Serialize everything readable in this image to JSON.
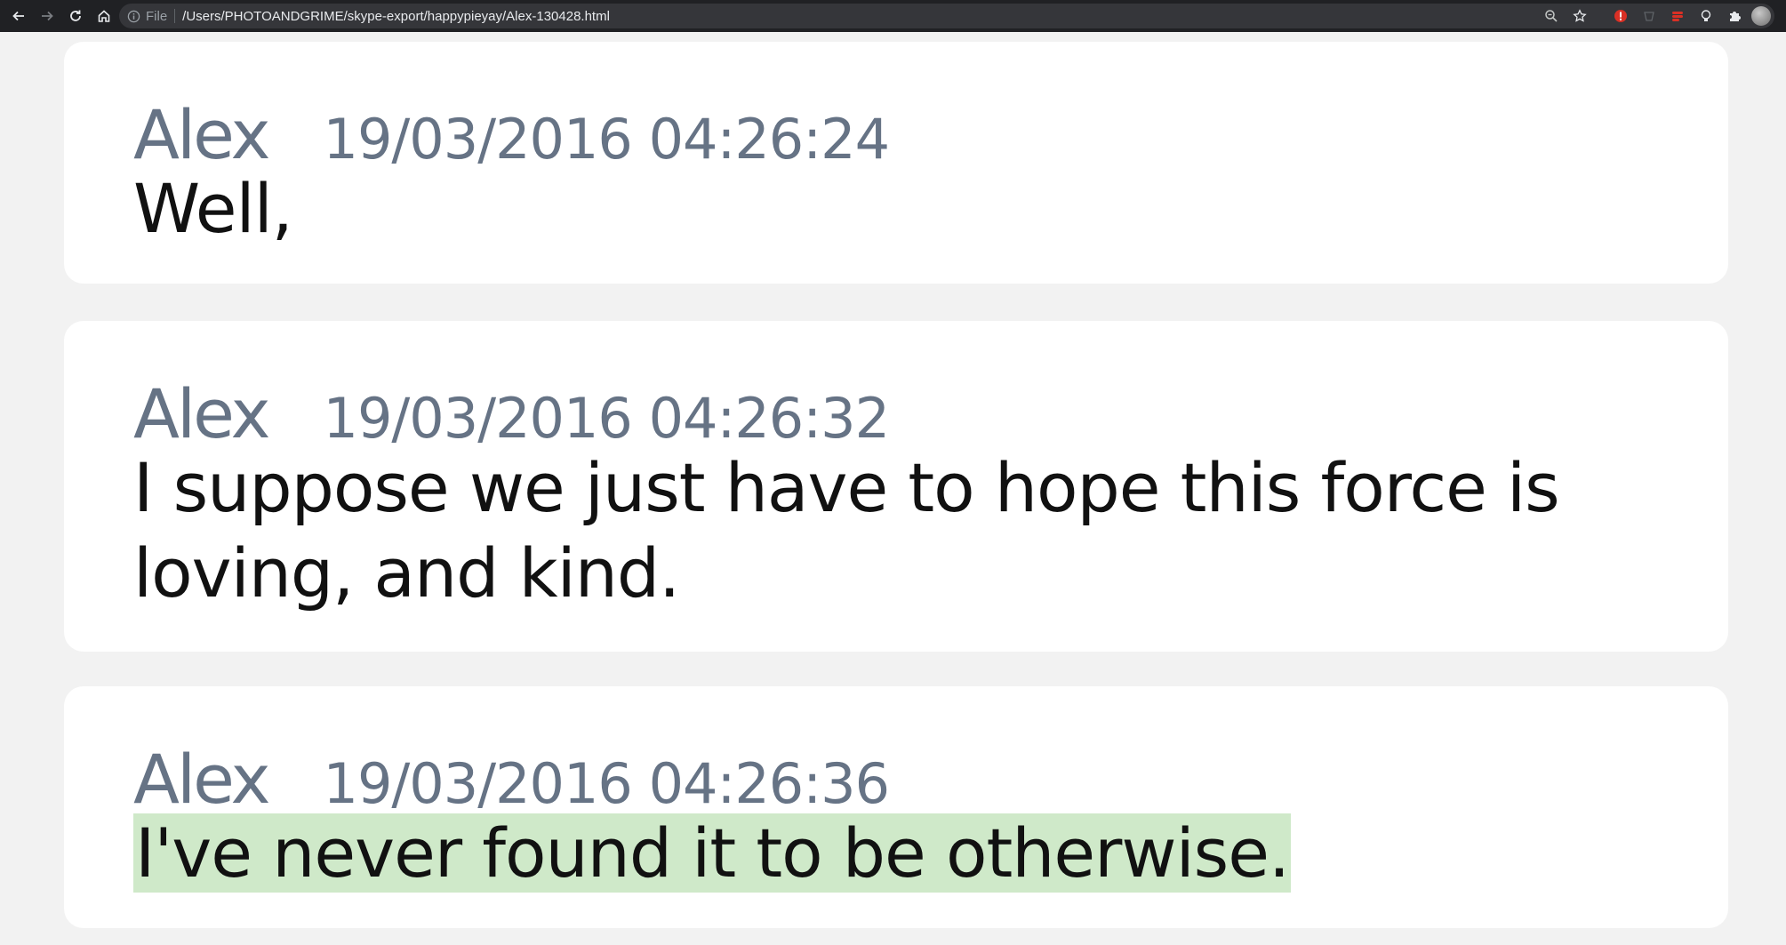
{
  "browser": {
    "scheme_label": "File",
    "url": "/Users/PHOTOANDGRIME/skype-export/happypieyay/Alex-130428.html",
    "nav_icons": [
      "back-arrow-icon",
      "forward-arrow-icon",
      "reload-icon",
      "home-icon"
    ],
    "omnibox_icons": [
      "info-icon",
      "zoom-icon",
      "bookmark-star-icon"
    ],
    "extension_icons": [
      "red-extension-icon",
      "gray-extension-icon",
      "red-stripes-extension-icon",
      "lightbulb-extension-icon",
      "puzzle-icon",
      "profile-avatar"
    ]
  },
  "messages": [
    {
      "author": "Alex",
      "timestamp": "19/03/2016 04:26:24",
      "lines": [
        "Well,"
      ],
      "highlighted": false
    },
    {
      "author": "Alex",
      "timestamp": "19/03/2016 04:26:32",
      "lines": [
        "I suppose we just have to hope this force is",
        "loving, and kind."
      ],
      "highlighted": false
    },
    {
      "author": "Alex",
      "timestamp": "19/03/2016 04:26:36",
      "lines": [
        "I've never found it to be otherwise."
      ],
      "highlighted": true,
      "highlight_color": "#cfe9c9"
    }
  ],
  "colors": {
    "toolbar_bg": "#202124",
    "page_bg": "#f2f2f2",
    "card_bg": "#ffffff",
    "meta_text": "#667385",
    "message_text": "#111111"
  }
}
